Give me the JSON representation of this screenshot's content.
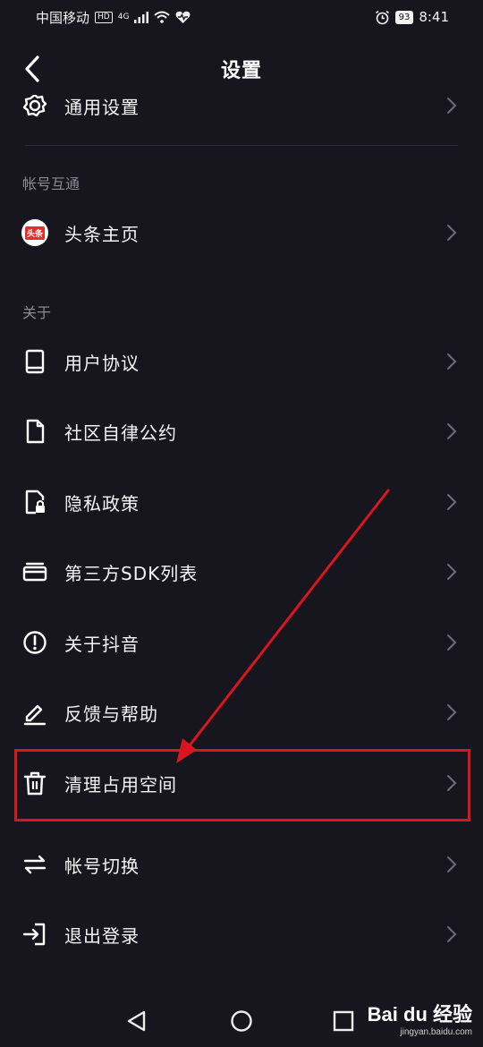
{
  "status_bar": {
    "carrier": "中国移动",
    "hd_badge": "HD",
    "network": "4G",
    "battery": "93",
    "time": "8:41"
  },
  "header": {
    "title": "设置"
  },
  "partial_row": {
    "label": "通用设置"
  },
  "account_section": {
    "title": "帐号互通",
    "toutiao_logo_text": "头条",
    "toutiao_label": "头条主页"
  },
  "about_section": {
    "title": "关于",
    "items": [
      {
        "label": "用户协议",
        "icon": "book-icon"
      },
      {
        "label": "社区自律公约",
        "icon": "document-icon"
      },
      {
        "label": "隐私政策",
        "icon": "privacy-lock-icon"
      },
      {
        "label": "第三方SDK列表",
        "icon": "card-stack-icon"
      },
      {
        "label": "关于抖音",
        "icon": "info-alert-icon"
      },
      {
        "label": "反馈与帮助",
        "icon": "pen-icon"
      },
      {
        "label": "清理占用空间",
        "icon": "trash-icon"
      },
      {
        "label": "帐号切换",
        "icon": "swap-icon"
      },
      {
        "label": "退出登录",
        "icon": "logout-icon"
      }
    ]
  },
  "annotation": {
    "color": "#d9161f"
  },
  "watermark": {
    "logo": "Bai du 经验",
    "url": "jingyan.baidu.com"
  }
}
